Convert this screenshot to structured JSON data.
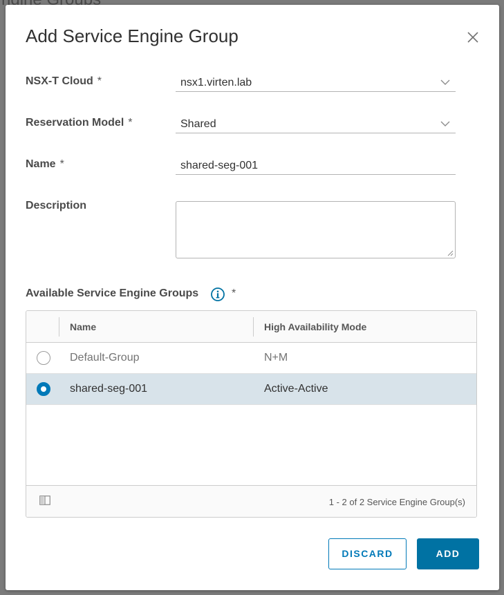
{
  "backdrop": {
    "text": "ngine Groups"
  },
  "dialog": {
    "title": "Add Service Engine Group",
    "close_icon": "close-icon"
  },
  "form": {
    "required_mark": "*",
    "cloud": {
      "label": "NSX-T Cloud",
      "value": "nsx1.virten.lab"
    },
    "reservation": {
      "label": "Reservation Model",
      "value": "Shared"
    },
    "name": {
      "label": "Name",
      "value": "shared-seg-001"
    },
    "description": {
      "label": "Description",
      "value": ""
    },
    "available": {
      "label": "Available Service Engine Groups",
      "info_icon": "info-icon"
    }
  },
  "grid": {
    "columns": [
      "Name",
      "High Availability Mode"
    ],
    "rows": [
      {
        "name": "Default-Group",
        "ha_mode": "N+M",
        "selected": false
      },
      {
        "name": "shared-seg-001",
        "ha_mode": "Active-Active",
        "selected": true
      }
    ],
    "footer": "1 - 2 of 2 Service Engine Group(s)"
  },
  "buttons": {
    "discard": "DISCARD",
    "add": "ADD"
  },
  "colors": {
    "primary": "#0072a3",
    "selected_row": "#d8e3ea",
    "backdrop": "#7b7b7b"
  }
}
